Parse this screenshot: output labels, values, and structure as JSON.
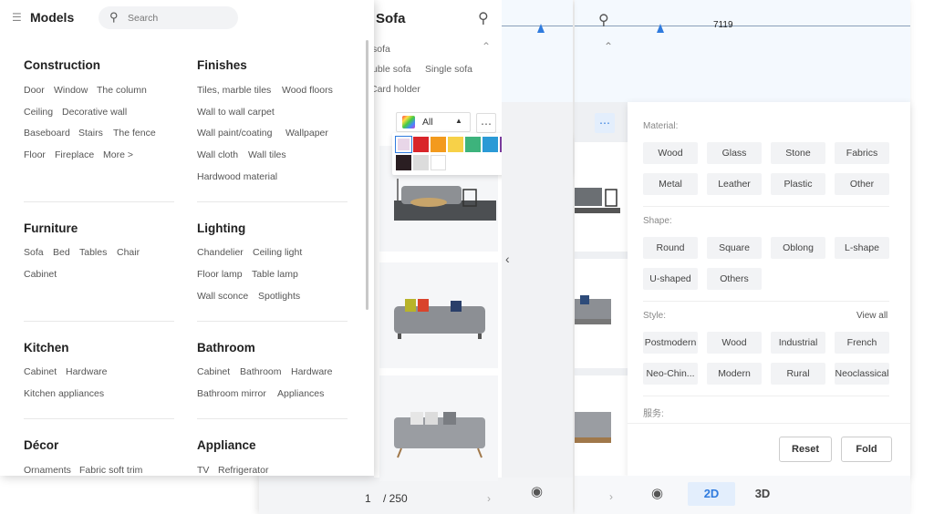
{
  "models_panel": {
    "title": "Models",
    "search_placeholder": "Search",
    "categories": [
      {
        "title": "Construction",
        "items": [
          "Door",
          "Window",
          "The column",
          "Ceiling",
          "Decorative wall",
          "Baseboard",
          "Stairs",
          "The fence",
          "Floor",
          "Fireplace",
          "More >"
        ]
      },
      {
        "title": "Finishes",
        "items": [
          "Tiles, marble tiles",
          "Wood floors",
          "Wall to wall carpet",
          "Wall paint/coating",
          "Wallpaper",
          "Wall cloth",
          "Wall tiles",
          "Hardwood material"
        ]
      },
      {
        "title": "Furniture",
        "items": [
          "Sofa",
          "Bed",
          "Tables",
          "Chair",
          "Cabinet"
        ]
      },
      {
        "title": "Lighting",
        "items": [
          "Chandelier",
          "Ceiling light",
          "Floor lamp",
          "Table lamp",
          "Wall sconce",
          "Spotlights"
        ]
      },
      {
        "title": "Kitchen",
        "items": [
          "Cabinet",
          "Hardware",
          "Kitchen appliances"
        ]
      },
      {
        "title": "Bathroom",
        "items": [
          "Cabinet",
          "Bathroom",
          "Hardware",
          "Bathroom mirror",
          "Appliances"
        ]
      },
      {
        "title": "Décor",
        "items": [
          "Ornaments",
          "Fabric soft trim"
        ]
      },
      {
        "title": "Appliance",
        "items": [
          "TV",
          "Refrigerator"
        ]
      }
    ]
  },
  "sofa_panel": {
    "ruler_value": "7119",
    "title": "Sofa",
    "subcategories": [
      "sofa",
      "uble sofa",
      "Single sofa",
      "Card holder"
    ],
    "color_filter_label": "All",
    "palette_colors": [
      "#e8d6e8",
      "#d9252a",
      "#f39a1d",
      "#f7d148",
      "#3db37c",
      "#2b9ad6",
      "#7a3b9c",
      "#9b7a4e",
      "#f07fab",
      "#ece4d6",
      "#2a1e22",
      "#dcdcdc",
      "#ffffff"
    ],
    "pagination": {
      "current": "1",
      "total": "/ 250",
      "next": "›"
    }
  },
  "filter_panel": {
    "ruler_value": "7119",
    "material": {
      "label": "Material:",
      "options": [
        "Wood",
        "Glass",
        "Stone",
        "Fabrics",
        "Metal",
        "Leather",
        "Plastic",
        "Other"
      ]
    },
    "shape": {
      "label": "Shape:",
      "options": [
        "Round",
        "Square",
        "Oblong",
        "L-shape",
        "U-shaped",
        "Others"
      ]
    },
    "style": {
      "label": "Style:",
      "view_all": "View all",
      "options": [
        "Postmodern",
        "Wood",
        "Industrial",
        "French",
        "Neo-Chin...",
        "Modern",
        "Rural",
        "Neoclassical"
      ]
    },
    "service": {
      "label": "服务:"
    },
    "reset_label": "Reset",
    "fold_label": "Fold",
    "view_tabs": [
      "2D",
      "3D"
    ]
  },
  "icons": {
    "search": "search-icon",
    "menu": "list-icon",
    "filter": "filter-icon",
    "eye": "eye-icon",
    "chevron_up": "chevron-up-icon",
    "chevron_left": "chevron-left-icon"
  },
  "accent_color": "#2f7bde"
}
